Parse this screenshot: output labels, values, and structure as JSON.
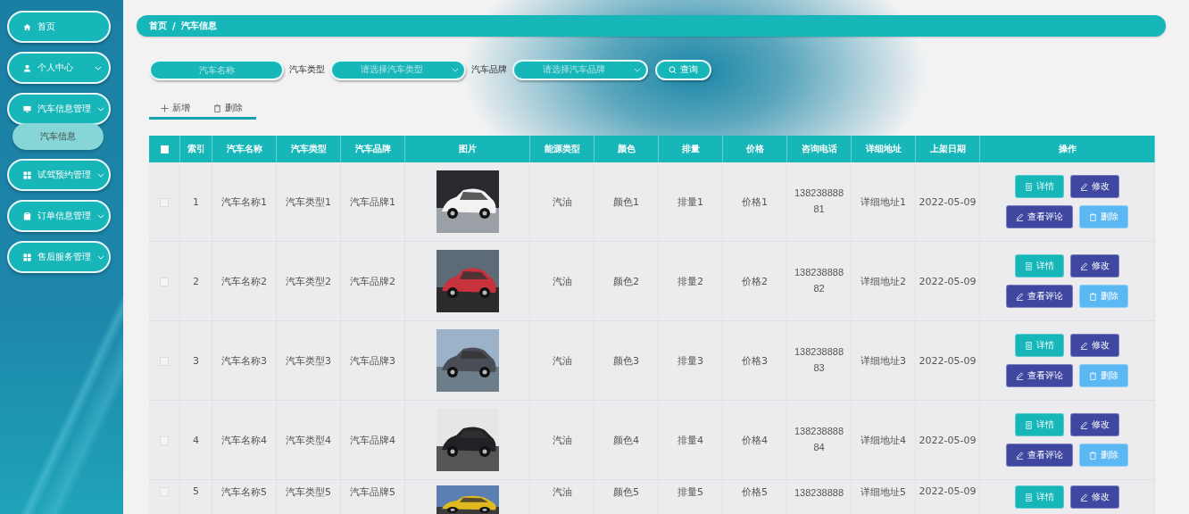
{
  "sidebar": {
    "items": [
      {
        "label": "首页",
        "kind": "link"
      },
      {
        "label": "个人中心",
        "kind": "submenu"
      },
      {
        "label": "汽车信息管理",
        "kind": "submenu",
        "children": [
          {
            "label": "汽车信息",
            "selected": true
          }
        ]
      },
      {
        "label": "试驾预约管理",
        "kind": "submenu"
      },
      {
        "label": "订单信息管理",
        "kind": "submenu"
      },
      {
        "label": "售后服务管理",
        "kind": "submenu"
      }
    ]
  },
  "breadcrumb": [
    "首页",
    "汽车信息"
  ],
  "breadcrumb_separator": "/",
  "search": {
    "name_field": {
      "placeholder": "汽车名称"
    },
    "filters": [
      {
        "label": "汽车类型",
        "placeholder": "请选择汽车类型"
      },
      {
        "label": "汽车品牌",
        "placeholder": "请选择汽车品牌"
      }
    ],
    "button": "查询"
  },
  "toolbar": [
    {
      "label": "新增",
      "kind": "add"
    },
    {
      "label": "删除",
      "kind": "delete"
    }
  ],
  "table": {
    "header_checked": false,
    "columns": [
      "索引",
      "汽车名称",
      "汽车类型",
      "汽车品牌",
      "图片",
      "能源类型",
      "颜色",
      "排量",
      "价格",
      "咨询电话",
      "详细地址",
      "上架日期",
      "操作"
    ],
    "rows": [
      {
        "checked": false,
        "cells": [
          "1",
          "汽车名称1",
          "汽车类型1",
          "汽车品牌1",
          {
            "kind": "picture"
          },
          "汽油",
          "颜色1",
          "排量1",
          "价格1",
          "13823888881",
          "详细地址1",
          "2022-05-09"
        ],
        "actions": [
          {
            "label": "详情",
            "kind": "detail"
          },
          {
            "label": "修改",
            "kind": "edit"
          },
          {
            "label": "查看评论",
            "kind": "comments"
          },
          {
            "label": "删除",
            "kind": "delete"
          }
        ]
      },
      {
        "checked": false,
        "cells": [
          "2",
          "汽车名称2",
          "汽车类型2",
          "汽车品牌2",
          {
            "kind": "picture"
          },
          "汽油",
          "颜色2",
          "排量2",
          "价格2",
          "13823888882",
          "详细地址2",
          "2022-05-09"
        ],
        "actions": [
          {
            "label": "详情",
            "kind": "detail"
          },
          {
            "label": "修改",
            "kind": "edit"
          },
          {
            "label": "查看评论",
            "kind": "comments"
          },
          {
            "label": "删除",
            "kind": "delete"
          }
        ]
      },
      {
        "checked": false,
        "cells": [
          "3",
          "汽车名称3",
          "汽车类型3",
          "汽车品牌3",
          {
            "kind": "picture"
          },
          "汽油",
          "颜色3",
          "排量3",
          "价格3",
          "13823888883",
          "详细地址3",
          "2022-05-09"
        ],
        "actions": [
          {
            "label": "详情",
            "kind": "detail"
          },
          {
            "label": "修改",
            "kind": "edit"
          },
          {
            "label": "查看评论",
            "kind": "comments"
          },
          {
            "label": "删除",
            "kind": "delete"
          }
        ]
      },
      {
        "checked": false,
        "cells": [
          "4",
          "汽车名称4",
          "汽车类型4",
          "汽车品牌4",
          {
            "kind": "picture"
          },
          "汽油",
          "颜色4",
          "排量4",
          "价格4",
          "13823888884",
          "详细地址4",
          "2022-05-09"
        ],
        "actions": [
          {
            "label": "详情",
            "kind": "detail"
          },
          {
            "label": "修改",
            "kind": "edit"
          },
          {
            "label": "查看评论",
            "kind": "comments"
          },
          {
            "label": "删除",
            "kind": "delete"
          }
        ]
      },
      {
        "checked": false,
        "cells": [
          "5",
          "汽车名称5",
          "汽车类型5",
          "汽车品牌5",
          {
            "kind": "picture"
          },
          "汽油",
          "颜色5",
          "排量5",
          "价格5",
          "138238888",
          "详细地址5",
          "2022-05-09"
        ],
        "actions": [
          {
            "label": "详情",
            "kind": "detail"
          },
          {
            "label": "修改",
            "kind": "edit"
          }
        ]
      }
    ]
  }
}
